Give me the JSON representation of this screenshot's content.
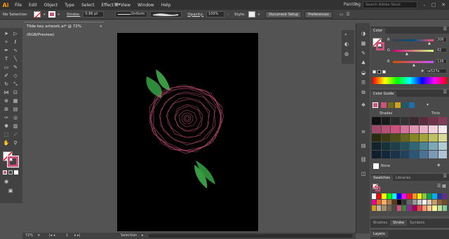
{
  "app": {
    "logo": "Ai"
  },
  "menubar": {
    "items": [
      "File",
      "Edit",
      "Object",
      "Type",
      "Select",
      "Effect",
      "View",
      "Window",
      "Help"
    ],
    "workspace": "Painting",
    "search_placeholder": "Search Adobe Stock"
  },
  "control_bar": {
    "selection": "No Selection",
    "stroke_label": "Stroke:",
    "stroke_weight": "0.86 pt",
    "profile": "Uniform",
    "opacity_label": "Opacity:",
    "opacity_value": "100%",
    "style_label": "Style:",
    "doc_setup": "Document Setup",
    "preferences": "Preferences"
  },
  "document": {
    "tab_title": "Tilde key artwork.ai* @ 72% (RGB/Preview)",
    "tab_close": "×"
  },
  "status": {
    "zoom": "72%",
    "page": "1",
    "tool": "Selection"
  },
  "color_panel": {
    "tab": "Color",
    "r_label": "R",
    "g_label": "G",
    "b_label": "B",
    "r_value": "206",
    "g_value": "82",
    "b_value": "126",
    "hex": "ce527e",
    "hex_prefix": "#"
  },
  "color_guide": {
    "tab": "Color Guide",
    "shades": "Shades",
    "tints": "Tints",
    "none_label": "None"
  },
  "swatches": {
    "tab_swatches": "Swatches",
    "tab_libraries": "Libraries"
  },
  "stroke_tabs": [
    "Brushes",
    "Stroke",
    "Symbols"
  ],
  "layers_tab": "Layers",
  "colors": {
    "accent": "#ce527e",
    "leaf": "#2e8b3a",
    "leaf_dark": "#1f6b2a"
  },
  "guide_palette": {
    "shades": [
      "#101010",
      "#1a1a1a",
      "#2a2a2a",
      "#333333",
      "#3d2a30",
      "#5a2b3c",
      "#6e3349",
      "#843d58"
    ],
    "tints_pink": [
      "#a04a6a",
      "#b55176",
      "#ce527e",
      "#d7729a",
      "#e193b1",
      "#eab2c7",
      "#f3d2de",
      "#f9ebf0"
    ],
    "olive": [
      "#2a2a10",
      "#3a3a14",
      "#4e4e18",
      "#66661d",
      "#858523",
      "#a3a338",
      "#bfbf63",
      "#dada98"
    ],
    "teal": [
      "#10242a",
      "#153139",
      "#1b4049",
      "#22505b",
      "#2e6776",
      "#4c8696",
      "#7aa8b5",
      "#b0ccd4"
    ],
    "blue": [
      "#101d2a",
      "#142639",
      "#1a3349",
      "#21425d",
      "#2c5677",
      "#4a7396",
      "#7a9ab6",
      "#b0c4d6"
    ]
  },
  "swatch_grid": [
    "#ffffff",
    "#ff0000",
    "#ffff00",
    "#00ff00",
    "#00ffff",
    "#0000ff",
    "#ff00ff",
    "#ed1c24",
    "#f7941d",
    "#fff200",
    "#8dc63f",
    "#00a651",
    "#00aeef",
    "#2e3192",
    "#662d91",
    "#ec008c",
    "#f26522",
    "#fbaf5d",
    "#a67c52",
    "#603913",
    "#000000",
    "#333333",
    "#666666",
    "#999999",
    "#cccccc",
    "#ffffff",
    "#e8c8b4",
    "#c69c6d",
    "#8c6239",
    "#754c24",
    "#d4a017",
    "#c7b299",
    "#a18e6c",
    "#736357",
    "#534741",
    "#ce527e",
    "#2e8b3a",
    "#92278f",
    "#9e005d",
    "#ef4136",
    "#f7977a",
    "#fdc689",
    "#fff799",
    "#c4df9b",
    "#82ca9c"
  ]
}
